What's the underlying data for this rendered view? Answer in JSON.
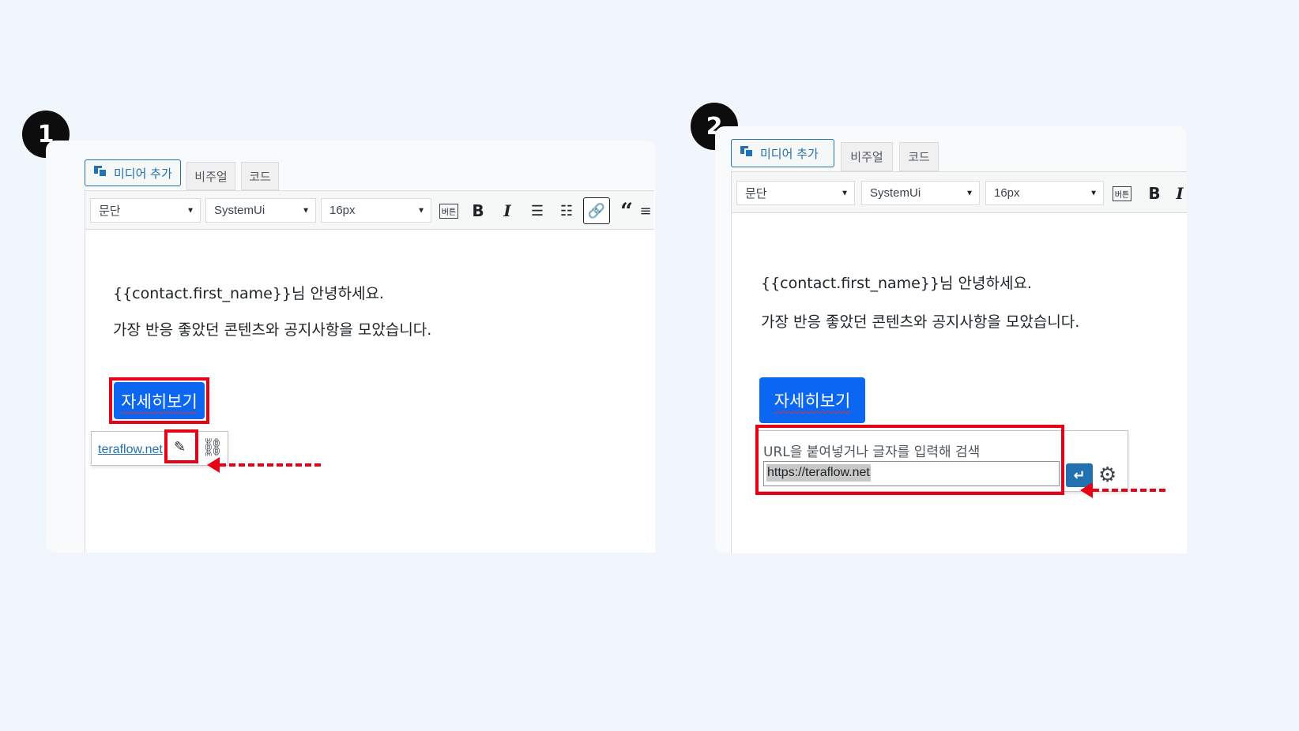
{
  "steps": [
    {
      "number": "1",
      "editor": {
        "tabs": {
          "media": "미디어 추가",
          "visual": "비주얼",
          "code": "코드"
        },
        "toolbar": {
          "format": "문단",
          "font": "SystemUi",
          "size": "16px",
          "button_icon": "버튼"
        },
        "content": {
          "greeting": "{{contact.first_name}}님 안녕하세요.",
          "intro": "가장 반응 좋았던 콘텐츠와 공지사항을 모았습니다."
        },
        "cta_label": "자세히보기",
        "link_popup": {
          "url_text": "teraflow.net",
          "edit_icon": "pencil-icon",
          "unlink_icon": "unlink-icon"
        }
      }
    },
    {
      "number": "2",
      "editor": {
        "tabs": {
          "media": "미디어 추가",
          "visual": "비주얼",
          "code": "코드"
        },
        "toolbar": {
          "format": "문단",
          "font": "SystemUi",
          "size": "16px",
          "button_icon": "버튼"
        },
        "content": {
          "greeting": "{{contact.first_name}}님 안녕하세요.",
          "intro": "가장 반응 좋았던 콘텐츠와 공지사항을 모았습니다."
        },
        "cta_label": "자세히보기",
        "link_dialog": {
          "hint": "URL을 붙여넣거나 글자를 입력해 검색",
          "url_value": "https://teraflow.net",
          "apply_icon": "enter-icon",
          "settings_icon": "gear-icon"
        }
      }
    }
  ],
  "colors": {
    "highlight": "#e80015",
    "cta": "#0b66f2",
    "link": "#2271b1"
  }
}
